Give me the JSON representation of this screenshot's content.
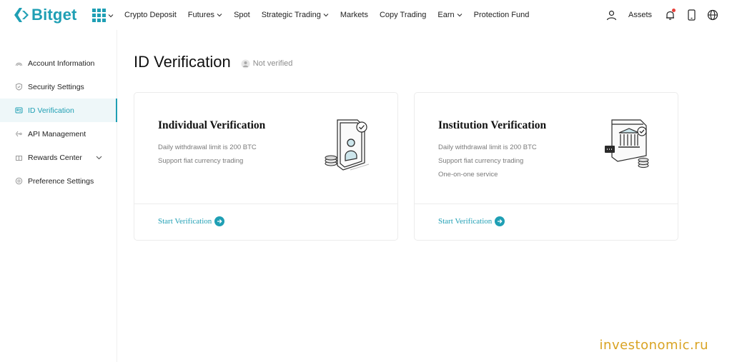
{
  "brand": {
    "name": "Bitget",
    "accent": "#1f9fb4"
  },
  "nav": {
    "items": [
      {
        "label": "Crypto Deposit",
        "dropdown": false
      },
      {
        "label": "Futures",
        "dropdown": true
      },
      {
        "label": "Spot",
        "dropdown": false
      },
      {
        "label": "Strategic Trading",
        "dropdown": true
      },
      {
        "label": "Markets",
        "dropdown": false
      },
      {
        "label": "Copy Trading",
        "dropdown": false
      },
      {
        "label": "Earn",
        "dropdown": true
      },
      {
        "label": "Protection Fund",
        "dropdown": false
      }
    ],
    "assets_label": "Assets",
    "icons": [
      "user-icon",
      "bell-icon",
      "phone-icon",
      "globe-icon"
    ]
  },
  "sidebar": {
    "items": [
      {
        "label": "Account Information",
        "icon": "account-icon"
      },
      {
        "label": "Security Settings",
        "icon": "shield-icon"
      },
      {
        "label": "ID Verification",
        "icon": "id-card-icon",
        "active": true
      },
      {
        "label": "API Management",
        "icon": "api-icon"
      },
      {
        "label": "Rewards Center",
        "icon": "gift-icon",
        "expandable": true
      },
      {
        "label": "Preference Settings",
        "icon": "settings-icon"
      }
    ]
  },
  "main": {
    "title": "ID Verification",
    "status": "Not verified",
    "cards": [
      {
        "title": "Individual Verification",
        "lines": [
          "Daily withdrawal limit is 200 BTC",
          "Support fiat currency trading"
        ],
        "cta": "Start Verification",
        "illustration": "phone-person-icon"
      },
      {
        "title": "Institution Verification",
        "lines": [
          "Daily withdrawal limit is 200 BTC",
          "Support fiat currency trading",
          "One-on-one service"
        ],
        "cta": "Start Verification",
        "illustration": "bank-building-icon"
      }
    ]
  },
  "watermark": "investonomic.ru"
}
